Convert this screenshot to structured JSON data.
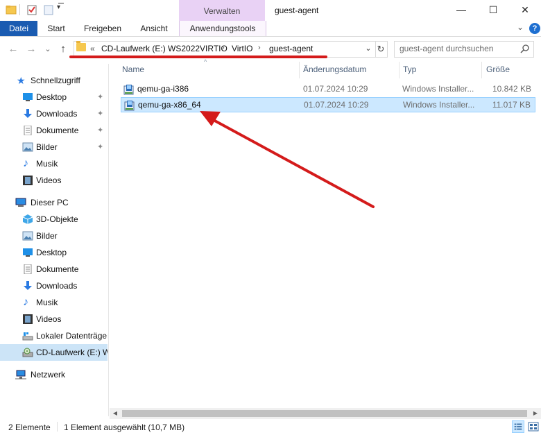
{
  "window": {
    "context_tab_header": "Verwalten",
    "title": "guest-agent",
    "minimize": "—",
    "maximize": "☐",
    "close": "✕"
  },
  "ribbon": {
    "tabs": [
      "Datei",
      "Start",
      "Freigeben",
      "Ansicht",
      "Anwendungstools"
    ],
    "expand_glyph": "⌄",
    "help_glyph": "?"
  },
  "nav": {
    "back": "←",
    "forward": "→",
    "recent": "⌄",
    "up": "↑"
  },
  "address": {
    "overflow": "«",
    "crumbs": [
      "CD-Laufwerk (E:) WS2022VIRTIO",
      "VirtIO",
      "guest-agent"
    ],
    "separator": "›",
    "dropdown": "⌄",
    "refresh": "↻"
  },
  "search": {
    "placeholder": "guest-agent durchsuchen"
  },
  "sidebar": {
    "quick_access": {
      "label": "Schnellzugriff",
      "items": [
        {
          "label": "Desktop",
          "icon": "desktop-icon",
          "pinned": true
        },
        {
          "label": "Downloads",
          "icon": "downloads-icon",
          "pinned": true
        },
        {
          "label": "Dokumente",
          "icon": "documents-icon",
          "pinned": true
        },
        {
          "label": "Bilder",
          "icon": "pictures-icon",
          "pinned": true
        },
        {
          "label": "Musik",
          "icon": "music-icon",
          "pinned": false
        },
        {
          "label": "Videos",
          "icon": "videos-icon",
          "pinned": false
        }
      ]
    },
    "this_pc": {
      "label": "Dieser PC",
      "items": [
        {
          "label": "3D-Objekte",
          "icon": "3d-objects-icon"
        },
        {
          "label": "Bilder",
          "icon": "pictures-icon"
        },
        {
          "label": "Desktop",
          "icon": "desktop-icon"
        },
        {
          "label": "Dokumente",
          "icon": "documents-icon"
        },
        {
          "label": "Downloads",
          "icon": "downloads-icon"
        },
        {
          "label": "Musik",
          "icon": "music-icon"
        },
        {
          "label": "Videos",
          "icon": "videos-icon"
        },
        {
          "label": "Lokaler Datenträger",
          "icon": "local-disk-icon"
        },
        {
          "label": "CD-Laufwerk (E:) W",
          "icon": "cd-drive-icon",
          "selected": true
        }
      ]
    },
    "network": {
      "label": "Netzwerk"
    },
    "pin_glyph": "📌"
  },
  "columns": {
    "name": "Name",
    "date": "Änderungsdatum",
    "type": "Typ",
    "size": "Größe",
    "sort_glyph": "^"
  },
  "files": [
    {
      "name": "qemu-ga-i386",
      "date": "01.07.2024 10:29",
      "type": "Windows Installer...",
      "size": "10.842 KB",
      "selected": false
    },
    {
      "name": "qemu-ga-x86_64",
      "date": "01.07.2024 10:29",
      "type": "Windows Installer...",
      "size": "11.017 KB",
      "selected": true
    }
  ],
  "scroll": {
    "left": "◀",
    "right": "▶"
  },
  "status": {
    "count": "2 Elemente",
    "selection": "1 Element ausgewählt (10,7 MB)"
  },
  "colors": {
    "accent": "#1a5bb1",
    "context_tab": "#e9d2f5",
    "selection": "#cce8ff",
    "annotation_red": "#d41b1b"
  }
}
